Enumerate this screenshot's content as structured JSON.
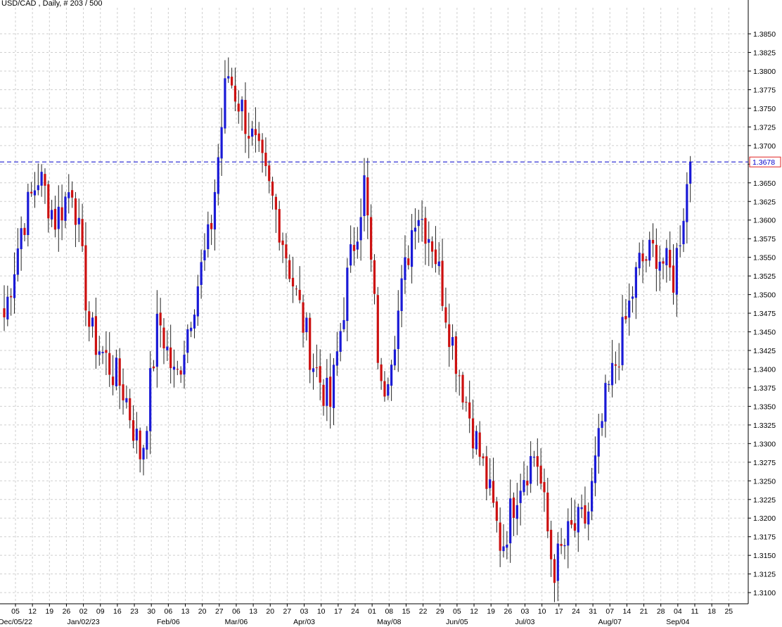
{
  "header": {
    "title": "USD/CAD , Daily, # 203 / 500"
  },
  "colors": {
    "up": "#1a1ad6",
    "down": "#cc1010",
    "wick": "#222222",
    "grid": "#cfcfcf",
    "axis": "#000000",
    "current_line": "#0000cc",
    "current_box_border": "#e02020",
    "background": "#ffffff"
  },
  "chart_data": {
    "type": "candlestick",
    "title": "USD/CAD , Daily, # 203 / 500",
    "ylim": [
      1.3085,
      1.3885
    ],
    "y_ticks": [
      "1.3100",
      "1.3125",
      "1.3150",
      "1.3175",
      "1.3200",
      "1.3225",
      "1.3250",
      "1.3275",
      "1.3300",
      "1.3325",
      "1.3350",
      "1.3375",
      "1.3400",
      "1.3425",
      "1.3450",
      "1.3475",
      "1.3500",
      "1.3525",
      "1.3550",
      "1.3575",
      "1.3600",
      "1.3625",
      "1.3650",
      "1.3675",
      "1.3700",
      "1.3725",
      "1.3750",
      "1.3775",
      "1.3800",
      "1.3825",
      "1.3850"
    ],
    "x_day_labels": [
      "05",
      "12",
      "19",
      "26",
      "02",
      "09",
      "16",
      "23",
      "30",
      "06",
      "13",
      "20",
      "27",
      "06",
      "13",
      "20",
      "27",
      "03",
      "10",
      "17",
      "24",
      "01",
      "08",
      "15",
      "22",
      "29",
      "05",
      "12",
      "19",
      "26",
      "03",
      "10",
      "17",
      "24",
      "31",
      "07",
      "14",
      "21",
      "28",
      "04",
      "11",
      "18",
      "25"
    ],
    "x_month_labels": [
      {
        "label": "Dec/05/22",
        "week": 0
      },
      {
        "label": "Jan/02/23",
        "week": 4
      },
      {
        "label": "Feb/06",
        "week": 9
      },
      {
        "label": "Mar/06",
        "week": 13
      },
      {
        "label": "Apr/03",
        "week": 17
      },
      {
        "label": "May/08",
        "week": 22
      },
      {
        "label": "Jun/05",
        "week": 26
      },
      {
        "label": "Jul/03",
        "week": 30
      },
      {
        "label": "Aug/07",
        "week": 35
      },
      {
        "label": "Sep/04",
        "week": 39
      }
    ],
    "current_price": "1.3678",
    "weekly_path": [
      1.347,
      1.359,
      1.366,
      1.36,
      1.365,
      1.345,
      1.341,
      1.337,
      1.328,
      1.347,
      1.338,
      1.349,
      1.358,
      1.38,
      1.374,
      1.367,
      1.36,
      1.35,
      1.341,
      1.335,
      1.352,
      1.365,
      1.336,
      1.348,
      1.362,
      1.357,
      1.345,
      1.335,
      1.326,
      1.316,
      1.325,
      1.329,
      1.313,
      1.318,
      1.32,
      1.335,
      1.344,
      1.354,
      1.356,
      1.352,
      1.3678
    ],
    "n_days": 203,
    "seed": 7
  }
}
